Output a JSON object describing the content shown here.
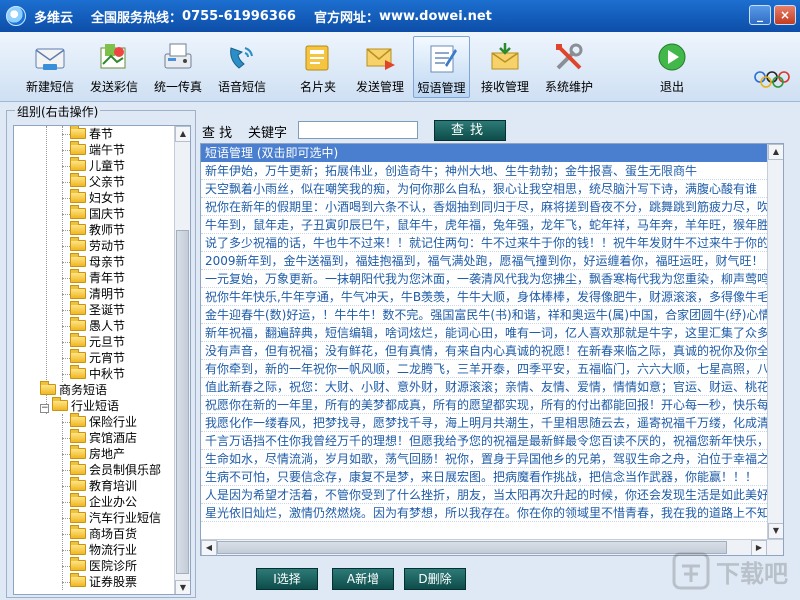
{
  "window": {
    "app_name": "多维云",
    "hotline_label": "全国服务热线：",
    "hotline": "0755-61996366",
    "website_label": "官方网址：",
    "website": "www.dowei.net"
  },
  "toolbar": {
    "items": [
      {
        "label": "新建短信",
        "icon": "new-sms-icon"
      },
      {
        "label": "发送彩信",
        "icon": "send-mms-icon"
      },
      {
        "label": "统一传真",
        "icon": "fax-icon"
      },
      {
        "label": "语音短信",
        "icon": "voice-sms-icon"
      },
      {
        "label": "名片夹",
        "icon": "business-card-icon"
      },
      {
        "label": "发送管理",
        "icon": "send-manage-icon"
      },
      {
        "label": "短语管理",
        "icon": "phrase-manage-icon"
      },
      {
        "label": "接收管理",
        "icon": "inbox-icon"
      },
      {
        "label": "系统维护",
        "icon": "maintenance-icon"
      },
      {
        "label": "退出",
        "icon": "exit-icon"
      }
    ],
    "active_index": 6
  },
  "tree": {
    "group_label": "组别(右击操作)",
    "items": [
      {
        "label": "春节",
        "level": 2
      },
      {
        "label": "端午节",
        "level": 2
      },
      {
        "label": "儿童节",
        "level": 2
      },
      {
        "label": "父亲节",
        "level": 2
      },
      {
        "label": "妇女节",
        "level": 2
      },
      {
        "label": "国庆节",
        "level": 2
      },
      {
        "label": "教师节",
        "level": 2
      },
      {
        "label": "劳动节",
        "level": 2
      },
      {
        "label": "母亲节",
        "level": 2
      },
      {
        "label": "青年节",
        "level": 2
      },
      {
        "label": "清明节",
        "level": 2
      },
      {
        "label": "圣诞节",
        "level": 2
      },
      {
        "label": "愚人节",
        "level": 2
      },
      {
        "label": "元旦节",
        "level": 2
      },
      {
        "label": "元宵节",
        "level": 2
      },
      {
        "label": "中秋节",
        "level": 2
      },
      {
        "label": "商务短语",
        "level": 1
      },
      {
        "label": "行业短语",
        "level": 1,
        "expanded": true
      },
      {
        "label": "保险行业",
        "level": 2
      },
      {
        "label": "宾馆酒店",
        "level": 2
      },
      {
        "label": "房地产",
        "level": 2
      },
      {
        "label": "会员制俱乐部",
        "level": 2
      },
      {
        "label": "教育培训",
        "level": 2
      },
      {
        "label": "企业办公",
        "level": 2
      },
      {
        "label": "汽车行业短信",
        "level": 2
      },
      {
        "label": "商场百货",
        "level": 2
      },
      {
        "label": "物流行业",
        "level": 2
      },
      {
        "label": "医院诊所",
        "level": 2
      },
      {
        "label": "证券股票",
        "level": 2
      }
    ]
  },
  "search": {
    "label1": "查 找",
    "label2": "关键字",
    "value": "",
    "button": "查找"
  },
  "phrases": {
    "header": "短语管理 (双击即可选中)",
    "rows": [
      "新年伊始，万牛更新；拓展伟业，创造奇牛；神州大地、生牛勃勃；金牛报喜、蛋生无限商牛",
      "天空飘着小雨丝，似在嘲笑我的痴，为何你那么自私，狠心让我空相思，统尽脑汁写下诗，满腹心酸有谁",
      "祝你在新年的假期里：小酒喝到六条不认，香烟抽到同归于尽，麻将搓到昏夜不分，跳舞跳到筋疲力尽，吹",
      "牛年到，鼠年走，子丑寅卯辰巳午，鼠年牛，虎年福，兔年强，龙年飞，蛇年祥，马年奔，羊年旺，猴年胜，鸡年升，狗年旺，十二生",
      "说了多少祝福的话，牛也牛不过来！！就记住两句：牛不过来牛于你的钱！！祝牛年发财牛不过来牛于你的",
      "2009新年到，金牛送福到，福娃抱福到，福气满处跑，愿福气撞到你，好运缠着你，福旺运旺，财气旺！",
      "一元复始，万象更新。一抹朝阳代我为您沐面，一袭清风代我为您拂尘，飘香寒梅代我为您重染，柳声莺鸣",
      "祝你牛年快乐,牛年亨通，牛气冲天，牛B羡羡，牛牛大顺，身体棒棒，发得像肥牛，财源滚滚，多得像牛毛",
      "金牛迎春牛(数)好运，！牛牛牛！数不完。强国富民牛(书)和谐，祥和奥运牛(属)中国，合家团圆牛(纾)心情，",
      "新年祝福，翻遍辞典，短信编辑，啥词炫烂，能词心田，唯有一词，亿人喜欢那就是牛字，这里汇集了众多I",
      "没有声音，但有祝福；没有鲜花，但有真情，有来自内心真诚的祝愿！在新春来临之际，真诚的祝你及你全",
      "有你牵到，新的一年祝你一帆风顺，二龙腾飞，三羊开泰，四季平安，五福临门，六六大顺，七星高照，八方",
      "值此新春之际，祝您：大财、小财、意外财，财源滚滚；亲情、友情、爱情，情情如意；官运、财运、桃花",
      "祝愿你在新的一年里，所有的美梦都成真，所有的愿望都实现，所有的付出都能回报！开心每一秒，快乐每",
      "我愿化作一缕春风，把梦找寻，愿梦找千寻，海上明月共潮生，千里相思随云去，遥寄祝福千万缕，化成清风入梦里，X",
      "千言万语挡不住你我曾经万千的理想！但愿我给予您的祝福是最新鲜最令您百读不厌的，祝福您新年快乐，",
      "生命如水，尽情流淌，岁月如歌，荡气回肠！祝你，置身于异国他乡的兄弟，驾驭生命之舟，泊位于幸福之",
      "生病不可怕，只要信念存，康复不是梦，来日展宏图。把病魔看作挑战，把信念当作武器，你能赢！！！",
      "人是因为希望才活着，不管你受到了什么挫折，朋友，当太阳再次升起的时候，你还会发现生活是如此美好",
      "星光依旧灿烂，激情仍然燃烧。因为有梦想，所以我存在。你在你的领域里不惜青春，我在我的道路上不知"
    ]
  },
  "actions": {
    "select": "I选择",
    "add": "A新增",
    "delete": "D删除"
  },
  "watermark": {
    "text": "下载吧"
  }
}
